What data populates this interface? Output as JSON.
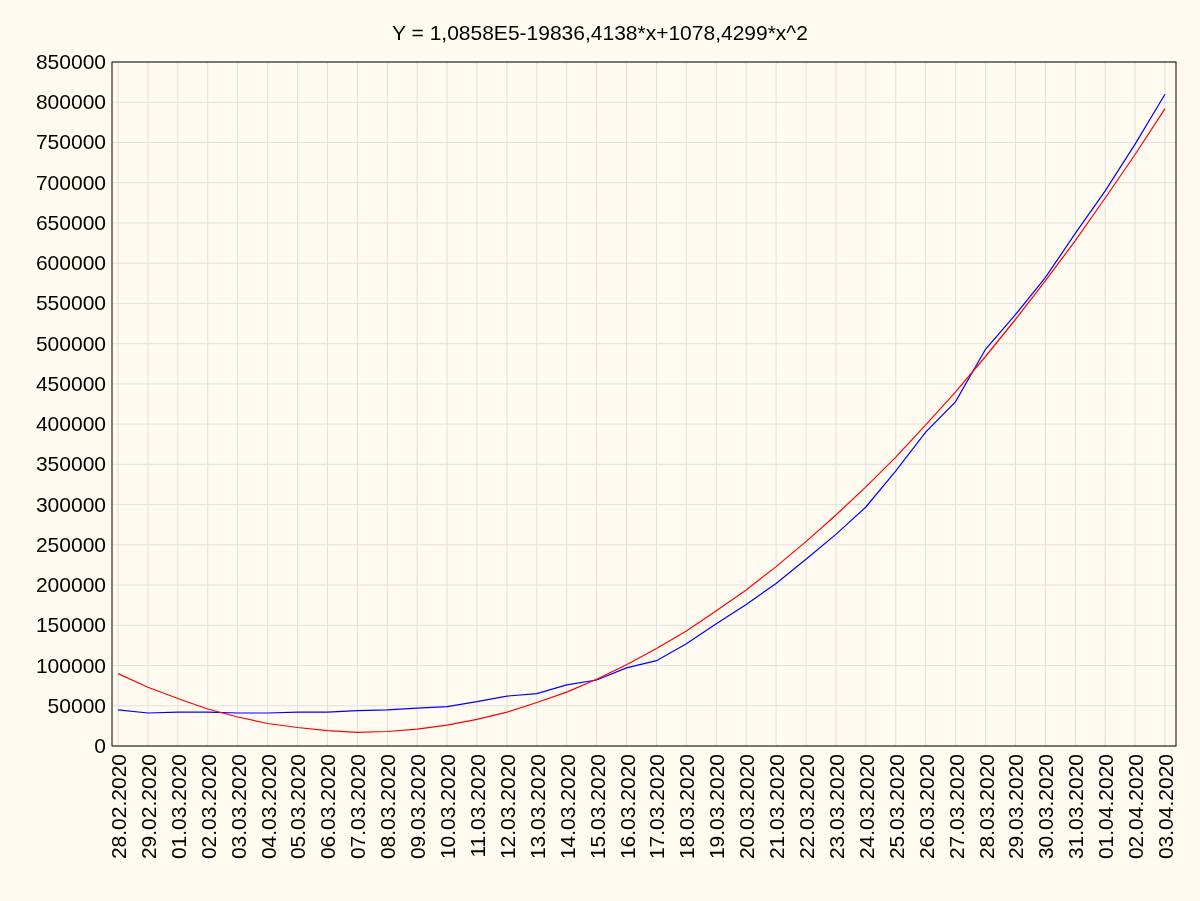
{
  "chart": {
    "chart_data": {
      "type": "line",
      "grid": true,
      "title": "Y = 1,0858E5-19836,4138*x+1078,4299*x^2",
      "categories": [
        "28.02.2020",
        "29.02.2020",
        "01.03.2020",
        "02.03.2020",
        "03.03.2020",
        "04.03.2020",
        "05.03.2020",
        "06.03.2020",
        "07.03.2020",
        "08.03.2020",
        "09.03.2020",
        "10.03.2020",
        "11.03.2020",
        "12.03.2020",
        "13.03.2020",
        "14.03.2020",
        "15.03.2020",
        "16.03.2020",
        "17.03.2020",
        "18.03.2020",
        "19.03.2020",
        "20.03.2020",
        "21.03.2020",
        "22.03.2020",
        "23.03.2020",
        "24.03.2020",
        "25.03.2020",
        "26.03.2020",
        "27.03.2020",
        "28.03.2020",
        "29.03.2020",
        "30.03.2020",
        "31.03.2020",
        "01.04.2020",
        "02.04.2020",
        "03.04.2020"
      ],
      "series": [
        {
          "color": "#0000ff",
          "values": [
            45000,
            41000,
            42000,
            42000,
            41000,
            41000,
            42000,
            42000,
            44000,
            45000,
            47000,
            49000,
            55000,
            62000,
            65000,
            76000,
            82000,
            97000,
            106000,
            127000,
            152000,
            176000,
            202000,
            232000,
            263000,
            297000,
            342000,
            390000,
            428000,
            493000,
            536000,
            582000,
            637000,
            690000,
            748000,
            810000
          ]
        },
        {
          "color": "#ff0000",
          "values": [
            90000,
            73000,
            59000,
            46000,
            36000,
            28000,
            23000,
            19000,
            17000,
            18000,
            21000,
            26000,
            33000,
            42000,
            54000,
            67000,
            83000,
            101000,
            121000,
            143000,
            168000,
            194000,
            223000,
            254000,
            287000,
            322000,
            359000,
            399000,
            440000,
            484000,
            530000,
            578000,
            628000,
            681000,
            735000,
            792000
          ]
        }
      ],
      "ylim": [
        0,
        850000
      ],
      "yticks": [
        0,
        50000,
        100000,
        150000,
        200000,
        250000,
        300000,
        350000,
        400000,
        450000,
        500000,
        550000,
        600000,
        650000,
        700000,
        750000,
        800000,
        850000
      ]
    }
  }
}
